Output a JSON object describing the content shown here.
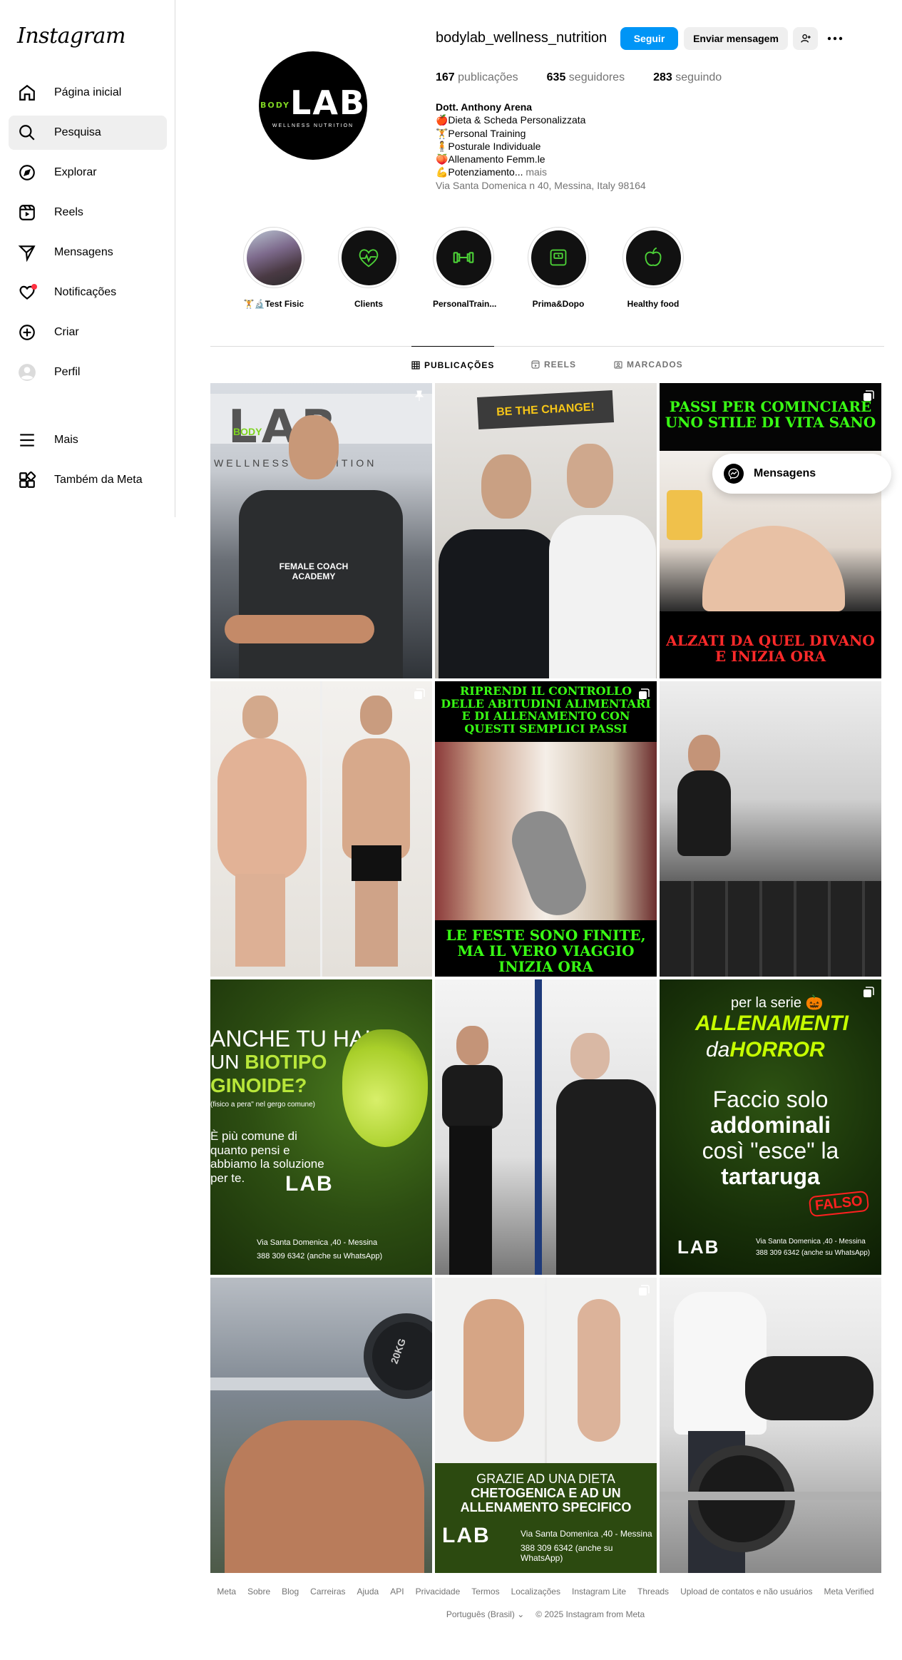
{
  "app": {
    "logo": "Instagram"
  },
  "sidebar": {
    "items": [
      {
        "label": "Página inicial",
        "icon": "home-icon"
      },
      {
        "label": "Pesquisa",
        "icon": "search-icon"
      },
      {
        "label": "Explorar",
        "icon": "compass-icon"
      },
      {
        "label": "Reels",
        "icon": "reels-icon"
      },
      {
        "label": "Mensagens",
        "icon": "send-icon"
      },
      {
        "label": "Notificações",
        "icon": "heart-icon"
      },
      {
        "label": "Criar",
        "icon": "plus-square-icon"
      },
      {
        "label": "Perfil",
        "icon": "avatar-icon"
      },
      {
        "label": "Mais",
        "icon": "menu-icon"
      },
      {
        "label": "Também da Meta",
        "icon": "meta-apps-icon"
      }
    ]
  },
  "profile": {
    "username": "bodylab_wellness_nutrition",
    "follow_label": "Seguir",
    "message_label": "Enviar mensagem",
    "stats": {
      "posts_count": "167",
      "posts_label": " publicações",
      "followers_count": "635",
      "followers_label": " seguidores",
      "following_count": "283",
      "following_label": " seguindo"
    },
    "avatar": {
      "brand": "LAB",
      "brand_small": "BODY",
      "subtitle": "WELLNESS NUTRITION"
    },
    "bio": {
      "name": "Dott. Anthony Arena",
      "lines": [
        "🍎Dieta & Scheda Personalizzata",
        "🏋️Personal Training",
        "🧍Posturale Individuale",
        "🍑Allenamento Femm.le",
        "💪Potenziamento..."
      ],
      "more": " mais",
      "address": "Via Santa Domenica n 40, Messina, Italy 98164"
    }
  },
  "highlights": [
    {
      "label": "🏋️🔬Test Fisic",
      "icon": "photo"
    },
    {
      "label": "Clients",
      "icon": "heart-pulse-icon"
    },
    {
      "label": "PersonalTrain...",
      "icon": "dumbbell-icon"
    },
    {
      "label": "Prima&Dopo",
      "icon": "scale-icon"
    },
    {
      "label": "Healthy food",
      "icon": "apple-icon"
    }
  ],
  "tabs": [
    {
      "label": "PUBLICAÇÕES",
      "icon": "grid-icon",
      "active": true
    },
    {
      "label": "REELS",
      "icon": "reels-icon",
      "active": false
    },
    {
      "label": "MARCADOS",
      "icon": "tag-icon",
      "active": false
    }
  ],
  "posts": {
    "p1": {
      "brand": "LAB",
      "brand_small": "BODY",
      "sub": "WELLNESS NUTRITION",
      "shirt": "FEMALE COACH ACADEMY"
    },
    "p2": {
      "sign": "BE THE CHANGE!"
    },
    "p3": {
      "top": "PASSI PER COMINCIARE UNO STILE DI VITA SANO",
      "bottom": "ALZATI DA QUEL DIVANO E INIZIA ORA"
    },
    "p5": {
      "top": "RIPRENDI IL CONTROLLO DELLE ABITUDINI ALIMENTARI E DI ALLENAMENTO CON QUESTI SEMPLICI PASSI",
      "bottom": "LE FESTE SONO FINITE, MA IL VERO VIAGGIO INIZIA ORA"
    },
    "p7": {
      "line1": "ANCHE TU HAI",
      "line2a": "UN ",
      "line2b": "BIOTIPO",
      "line3": "GINOIDE?",
      "note": "(fisico a pera\" nel gergo comune)",
      "body": "È più comune di quanto pensi e abbiamo la soluzione per te.",
      "addr": "Via Santa Domenica ,40 - Messina",
      "phone": "388 309 6342 (anche su WhatsApp)",
      "brand": "LAB"
    },
    "p9": {
      "pre": "per la serie 🎃",
      "title1": "ALLENAMENTI",
      "title2a": "da",
      "title2b": "HORROR",
      "body1": "Faccio solo",
      "body2": "addominali",
      "body3": "così \"esce\" la",
      "body4": "tartaruga",
      "stamp": "FALSO",
      "addr": "Via Santa Domenica ,40 - Messina",
      "phone": "388 309 6342 (anche su WhatsApp)",
      "brand": "LAB"
    },
    "p10": {
      "plate": "20KG"
    },
    "p11": {
      "line1": "GRAZIE AD UNA DIETA",
      "line2": "CHETOGENICA E AD UN",
      "line3": "ALLENAMENTO SPECIFICO",
      "addr": "Via Santa Domenica ,40 - Messina",
      "phone": "388 309 6342 (anche su WhatsApp)",
      "brand": "LAB"
    }
  },
  "popup": {
    "label": "Mensagens"
  },
  "footer": {
    "links": [
      "Meta",
      "Sobre",
      "Blog",
      "Carreiras",
      "Ajuda",
      "API",
      "Privacidade",
      "Termos",
      "Localizações",
      "Instagram Lite",
      "Threads",
      "Upload de contatos e não usuários",
      "Meta Verified"
    ],
    "language": "Português (Brasil)",
    "copyright": "© 2025 Instagram from Meta"
  }
}
